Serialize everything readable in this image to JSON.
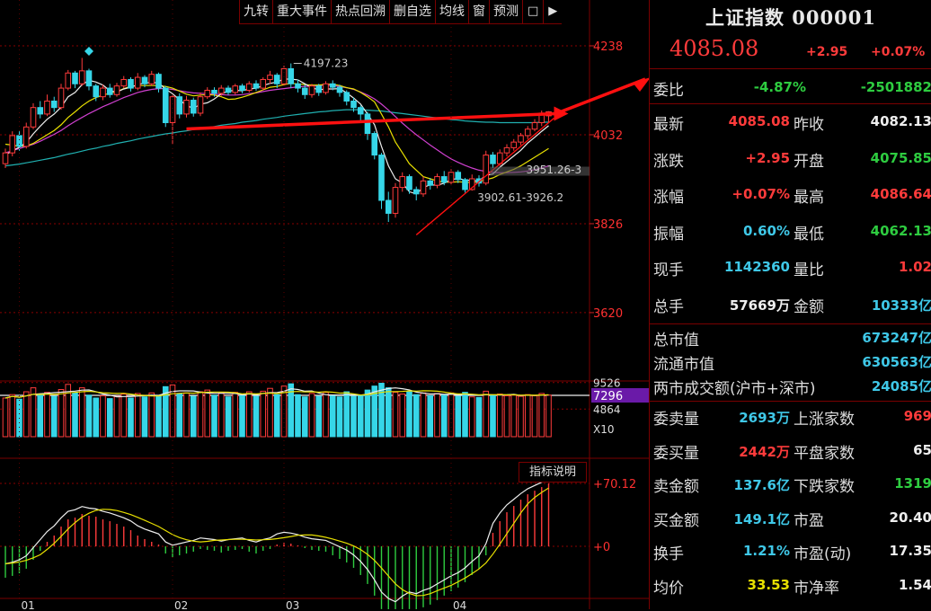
{
  "toolbar": {
    "items": [
      "九转",
      "重大事件",
      "热点回溯",
      "删自选",
      "均线",
      "窗",
      "预测"
    ],
    "lock_icon": "lock-icon",
    "exit_icon": "exit-icon"
  },
  "indicator_button": "指标说明",
  "colors": {
    "up": "#ff3b3b",
    "down": "#36d6e8",
    "ma5": "#eeeeee",
    "ma10": "#e8e000",
    "ma20": "#d040d0",
    "ma60": "#20b0b0",
    "arrow": "#ff1010"
  },
  "chart_data": {
    "type": "candlestick",
    "price_axis": {
      "ticks": [
        "4238",
        "4032",
        "3826",
        "3620"
      ],
      "ylim": [
        3470,
        4290
      ]
    },
    "volume_axis": {
      "ticks": [
        "9526",
        "4864",
        "X10"
      ],
      "current": "7296",
      "ylim": [
        0,
        9800
      ]
    },
    "macd_axis": {
      "ticks": [
        "+70.12",
        "+0"
      ],
      "ylim": [
        -95,
        105
      ]
    },
    "x_ticks": [
      {
        "label": "01",
        "index": 2
      },
      {
        "label": "02",
        "index": 24
      },
      {
        "label": "03",
        "index": 40
      },
      {
        "label": "04",
        "index": 64
      }
    ],
    "annotations": [
      {
        "text": "4197.23",
        "index": 41,
        "value": 4197.23,
        "kind": "high"
      },
      {
        "text": "3951.26-3",
        "index": 74,
        "value": 3951,
        "kind": "label"
      },
      {
        "text": "3902.61-3926.2",
        "index": 67,
        "value": 3902.61,
        "kind": "label"
      }
    ],
    "candles": [
      {
        "o": 3965,
        "c": 3990,
        "h": 4000,
        "l": 3955
      },
      {
        "o": 3990,
        "c": 4030,
        "h": 4040,
        "l": 3982
      },
      {
        "o": 4030,
        "c": 4005,
        "h": 4040,
        "l": 3995
      },
      {
        "o": 4005,
        "c": 4050,
        "h": 4060,
        "l": 4000
      },
      {
        "o": 4050,
        "c": 4095,
        "h": 4105,
        "l": 4045
      },
      {
        "o": 4095,
        "c": 4080,
        "h": 4110,
        "l": 4070
      },
      {
        "o": 4080,
        "c": 4110,
        "h": 4125,
        "l": 4075
      },
      {
        "o": 4110,
        "c": 4095,
        "h": 4120,
        "l": 4085
      },
      {
        "o": 4095,
        "c": 4140,
        "h": 4150,
        "l": 4090
      },
      {
        "o": 4140,
        "c": 4175,
        "h": 4182,
        "l": 4135
      },
      {
        "o": 4175,
        "c": 4150,
        "h": 4180,
        "l": 4140
      },
      {
        "o": 4150,
        "c": 4180,
        "h": 4210,
        "l": 4145
      },
      {
        "o": 4180,
        "c": 4145,
        "h": 4185,
        "l": 4135
      },
      {
        "o": 4145,
        "c": 4120,
        "h": 4150,
        "l": 4110
      },
      {
        "o": 4120,
        "c": 4140,
        "h": 4148,
        "l": 4112
      },
      {
        "o": 4140,
        "c": 4125,
        "h": 4150,
        "l": 4118
      },
      {
        "o": 4125,
        "c": 4145,
        "h": 4152,
        "l": 4120
      },
      {
        "o": 4145,
        "c": 4160,
        "h": 4168,
        "l": 4140
      },
      {
        "o": 4160,
        "c": 4140,
        "h": 4165,
        "l": 4132
      },
      {
        "o": 4140,
        "c": 4165,
        "h": 4175,
        "l": 4135
      },
      {
        "o": 4165,
        "c": 4150,
        "h": 4170,
        "l": 4142
      },
      {
        "o": 4150,
        "c": 4172,
        "h": 4180,
        "l": 4145
      },
      {
        "o": 4172,
        "c": 4140,
        "h": 4176,
        "l": 4130
      },
      {
        "o": 4140,
        "c": 4060,
        "h": 4145,
        "l": 4050
      },
      {
        "o": 4060,
        "c": 4120,
        "h": 4125,
        "l": 4010
      },
      {
        "o": 4120,
        "c": 4080,
        "h": 4128,
        "l": 4070
      },
      {
        "o": 4080,
        "c": 4112,
        "h": 4122,
        "l": 4072
      },
      {
        "o": 4112,
        "c": 4082,
        "h": 4118,
        "l": 4074
      },
      {
        "o": 4082,
        "c": 4120,
        "h": 4130,
        "l": 4075
      },
      {
        "o": 4120,
        "c": 4135,
        "h": 4142,
        "l": 4115
      },
      {
        "o": 4135,
        "c": 4128,
        "h": 4142,
        "l": 4120
      },
      {
        "o": 4128,
        "c": 4140,
        "h": 4147,
        "l": 4122
      },
      {
        "o": 4140,
        "c": 4130,
        "h": 4146,
        "l": 4124
      },
      {
        "o": 4130,
        "c": 4145,
        "h": 4150,
        "l": 4125
      },
      {
        "o": 4145,
        "c": 4135,
        "h": 4150,
        "l": 4128
      },
      {
        "o": 4135,
        "c": 4150,
        "h": 4156,
        "l": 4130
      },
      {
        "o": 4150,
        "c": 4140,
        "h": 4158,
        "l": 4134
      },
      {
        "o": 4140,
        "c": 4160,
        "h": 4165,
        "l": 4135
      },
      {
        "o": 4160,
        "c": 4170,
        "h": 4180,
        "l": 4150
      },
      {
        "o": 4170,
        "c": 4150,
        "h": 4175,
        "l": 4140
      },
      {
        "o": 4150,
        "c": 4185,
        "h": 4192,
        "l": 4145
      },
      {
        "o": 4185,
        "c": 4150,
        "h": 4197.23,
        "l": 4140
      },
      {
        "o": 4150,
        "c": 4140,
        "h": 4160,
        "l": 4130
      },
      {
        "o": 4140,
        "c": 4125,
        "h": 4148,
        "l": 4115
      },
      {
        "o": 4125,
        "c": 4145,
        "h": 4150,
        "l": 4118
      },
      {
        "o": 4145,
        "c": 4130,
        "h": 4150,
        "l": 4122
      },
      {
        "o": 4130,
        "c": 4150,
        "h": 4156,
        "l": 4125
      },
      {
        "o": 4150,
        "c": 4142,
        "h": 4158,
        "l": 4135
      },
      {
        "o": 4142,
        "c": 4130,
        "h": 4148,
        "l": 4120
      },
      {
        "o": 4130,
        "c": 4110,
        "h": 4135,
        "l": 4100
      },
      {
        "o": 4110,
        "c": 4095,
        "h": 4118,
        "l": 4085
      },
      {
        "o": 4095,
        "c": 4080,
        "h": 4100,
        "l": 4065
      },
      {
        "o": 4080,
        "c": 4035,
        "h": 4085,
        "l": 4020
      },
      {
        "o": 4035,
        "c": 3985,
        "h": 4040,
        "l": 3975
      },
      {
        "o": 3985,
        "c": 3880,
        "h": 3990,
        "l": 3860
      },
      {
        "o": 3880,
        "c": 3850,
        "h": 3900,
        "l": 3830
      },
      {
        "o": 3850,
        "c": 3910,
        "h": 3920,
        "l": 3840
      },
      {
        "o": 3910,
        "c": 3935,
        "h": 3945,
        "l": 3900
      },
      {
        "o": 3935,
        "c": 3905,
        "h": 3940,
        "l": 3895
      },
      {
        "o": 3905,
        "c": 3895,
        "h": 3912,
        "l": 3880
      },
      {
        "o": 3895,
        "c": 3925,
        "h": 3935,
        "l": 3888
      },
      {
        "o": 3925,
        "c": 3915,
        "h": 3932,
        "l": 3905
      },
      {
        "o": 3915,
        "c": 3935,
        "h": 3942,
        "l": 3908
      },
      {
        "o": 3935,
        "c": 3922,
        "h": 3948,
        "l": 3915
      },
      {
        "o": 3922,
        "c": 3945,
        "h": 3952,
        "l": 3915
      },
      {
        "o": 3945,
        "c": 3928,
        "h": 3950,
        "l": 3920
      },
      {
        "o": 3928,
        "c": 3905,
        "h": 3932,
        "l": 3898
      },
      {
        "o": 3905,
        "c": 3930,
        "h": 3940,
        "l": 3902.61
      },
      {
        "o": 3930,
        "c": 3920,
        "h": 3938,
        "l": 3912
      },
      {
        "o": 3920,
        "c": 3985,
        "h": 3995,
        "l": 3915
      },
      {
        "o": 3985,
        "c": 3965,
        "h": 3992,
        "l": 3955
      },
      {
        "o": 3965,
        "c": 3990,
        "h": 3998,
        "l": 3960
      },
      {
        "o": 3990,
        "c": 4002,
        "h": 4010,
        "l": 3982
      },
      {
        "o": 4002,
        "c": 4015,
        "h": 4022,
        "l": 3995
      },
      {
        "o": 4015,
        "c": 4030,
        "h": 4036,
        "l": 4008
      },
      {
        "o": 4030,
        "c": 4045,
        "h": 4052,
        "l": 4022
      },
      {
        "o": 4045,
        "c": 4060,
        "h": 4068,
        "l": 4040
      },
      {
        "o": 4060,
        "c": 4082.13,
        "h": 4088,
        "l": 4052
      },
      {
        "o": 4075.85,
        "c": 4085.08,
        "h": 4086.64,
        "l": 4062.13
      }
    ],
    "volume": [
      6800,
      7400,
      6600,
      7900,
      8600,
      7300,
      7800,
      7100,
      8300,
      9200,
      7700,
      8600,
      7300,
      6800,
      7200,
      6700,
      7100,
      7500,
      6800,
      7600,
      7000,
      7700,
      7200,
      8800,
      9100,
      7500,
      7700,
      7100,
      7900,
      8200,
      7300,
      7700,
      7000,
      7800,
      7200,
      7900,
      7100,
      8000,
      8500,
      7400,
      8900,
      9300,
      7400,
      7000,
      7600,
      7100,
      7800,
      7200,
      7000,
      7900,
      7100,
      7300,
      8200,
      8900,
      9400,
      8600,
      7800,
      7500,
      7900,
      7400,
      7700,
      7200,
      7600,
      7300,
      7700,
      7100,
      7800,
      7000,
      6900,
      8000,
      7200,
      7500,
      7200,
      7300,
      7100,
      7400,
      7200,
      7600,
      7300
    ],
    "macd": [
      -35,
      -33,
      -30,
      -25,
      -15,
      -5,
      5,
      12,
      22,
      30,
      32,
      36,
      34,
      33,
      30,
      28,
      25,
      22,
      18,
      12,
      8,
      5,
      2,
      -8,
      -12,
      -10,
      -8,
      -6,
      -3,
      -4,
      -5,
      -7,
      -5,
      -4,
      -3,
      -6,
      -8,
      -5,
      -3,
      2,
      4,
      3,
      1,
      -2,
      -4,
      -5,
      -6,
      -10,
      -14,
      -18,
      -24,
      -32,
      -42,
      -55,
      -70,
      -78,
      -82,
      -75,
      -70,
      -72,
      -68,
      -65,
      -60,
      -55,
      -50,
      -46,
      -40,
      -32,
      -25,
      -10,
      15,
      28,
      38,
      45,
      52,
      58,
      62,
      66,
      70.12
    ],
    "ma5": [
      3985,
      3995,
      4003,
      4014,
      4034,
      4052,
      4068,
      4080,
      4096,
      4120,
      4130,
      4148,
      4158,
      4154,
      4147,
      4134,
      4131,
      4138,
      4142,
      4148,
      4152,
      4153,
      4152,
      4138,
      4127,
      4113,
      4100,
      4093,
      4103,
      4106,
      4115,
      4127,
      4133,
      4135,
      4134,
      4138,
      4140,
      4146,
      4151,
      4154,
      4161,
      4161,
      4159,
      4150,
      4141,
      4136,
      4138,
      4138,
      4139,
      4129,
      4117,
      4103,
      4080,
      4055,
      4005,
      3960,
      3930,
      3920,
      3900,
      3895,
      3910,
      3916,
      3915,
      3920,
      3928,
      3931,
      3927,
      3926,
      3925,
      3938,
      3941,
      3957,
      3970,
      3983,
      3996,
      4013,
      4026,
      4040,
      4053
    ],
    "ma10": [
      4010,
      4008,
      4005,
      4006,
      4012,
      4022,
      4032,
      4042,
      4055,
      4072,
      4085,
      4099,
      4110,
      4118,
      4124,
      4128,
      4132,
      4139,
      4144,
      4146,
      4146,
      4146,
      4146,
      4144,
      4140,
      4133,
      4126,
      4122,
      4124,
      4125,
      4124,
      4120,
      4114,
      4115,
      4119,
      4124,
      4130,
      4136,
      4142,
      4144,
      4148,
      4151,
      4150,
      4148,
      4147,
      4147,
      4149,
      4149,
      4146,
      4141,
      4138,
      4130,
      4120,
      4108,
      4080,
      4050,
      4015,
      3990,
      3965,
      3950,
      3935,
      3930,
      3925,
      3922,
      3922,
      3923,
      3922,
      3921,
      3923,
      3928,
      3932,
      3940,
      3946,
      3952,
      3960,
      3970,
      3980,
      3990,
      4000
    ],
    "ma20": [
      3990,
      3995,
      4000,
      4005,
      4010,
      4017,
      4025,
      4033,
      4042,
      4053,
      4063,
      4072,
      4081,
      4089,
      4097,
      4104,
      4111,
      4118,
      4124,
      4130,
      4134,
      4137,
      4139,
      4139,
      4137,
      4134,
      4131,
      4129,
      4128,
      4127,
      4126,
      4125,
      4124,
      4124,
      4125,
      4127,
      4129,
      4132,
      4135,
      4137,
      4139,
      4141,
      4143,
      4144,
      4145,
      4146,
      4147,
      4146,
      4144,
      4141,
      4137,
      4131,
      4124,
      4115,
      4103,
      4089,
      4074,
      4059,
      4045,
      4032,
      4020,
      4008,
      3997,
      3986,
      3976,
      3968,
      3961,
      3955,
      3950,
      3947,
      3945,
      3944,
      3944,
      3945,
      3946,
      3948,
      3951,
      3955,
      3960
    ],
    "ma60": [
      3960,
      3962,
      3964,
      3967,
      3970,
      3973,
      3976,
      3979,
      3983,
      3987,
      3990,
      3994,
      3998,
      4001,
      4005,
      4008,
      4012,
      4015,
      4018,
      4022,
      4025,
      4028,
      4031,
      4034,
      4036,
      4039,
      4041,
      4044,
      4046,
      4049,
      4051,
      4054,
      4056,
      4058,
      4061,
      4063,
      4065,
      4068,
      4070,
      4072,
      4075,
      4077,
      4079,
      4081,
      4083,
      4085,
      4086,
      4088,
      4089,
      4090,
      4090,
      4090,
      4089,
      4088,
      4087,
      4085,
      4083,
      4081,
      4079,
      4077,
      4075,
      4073,
      4071,
      4069,
      4067,
      4066,
      4064,
      4063,
      4062,
      4061,
      4061,
      4060,
      4060,
      4060,
      4060,
      4060,
      4060,
      4061,
      4061
    ]
  },
  "quote": {
    "title": "上证指数 000001",
    "price": "4085.08",
    "change": "+2.95",
    "change_pct": "+0.07%",
    "weibi": {
      "label": "委比",
      "pct": "-4.87%",
      "diff": "-2501882"
    },
    "rows": [
      {
        "l1": "最新",
        "v1": "4085.08",
        "c1": "red",
        "l2": "昨收",
        "v2": "4082.13",
        "c2": "white"
      },
      {
        "l1": "涨跌",
        "v1": "+2.95",
        "c1": "red",
        "l2": "开盘",
        "v2": "4075.85",
        "c2": "green"
      },
      {
        "l1": "涨幅",
        "v1": "+0.07%",
        "c1": "red",
        "l2": "最高",
        "v2": "4086.64",
        "c2": "red"
      },
      {
        "l1": "振幅",
        "v1": "0.60%",
        "c1": "cyan",
        "l2": "最低",
        "v2": "4062.13",
        "c2": "green"
      },
      {
        "l1": "现手",
        "v1": "1142360",
        "c1": "cyan",
        "l2": "量比",
        "v2": "1.02",
        "c2": "red"
      },
      {
        "l1": "总手",
        "v1": "57669万",
        "c1": "white",
        "l2": "金额",
        "v2": "10333亿",
        "c2": "cyan"
      }
    ],
    "market": [
      {
        "label": "总市值",
        "value": "673247亿"
      },
      {
        "label": "流通市值",
        "value": "630563亿"
      },
      {
        "label": "两市成交额(沪市+深市)",
        "value": "24085亿"
      }
    ],
    "rows2": [
      {
        "l1": "委卖量",
        "v1": "2693万",
        "c1": "cyan",
        "l2": "上涨家数",
        "v2": "969",
        "c2": "red"
      },
      {
        "l1": "委买量",
        "v1": "2442万",
        "c1": "red",
        "l2": "平盘家数",
        "v2": "65",
        "c2": "white"
      },
      {
        "l1": "卖金额",
        "v1": "137.6亿",
        "c1": "cyan",
        "l2": "下跌家数",
        "v2": "1319",
        "c2": "green"
      },
      {
        "l1": "买金额",
        "v1": "149.1亿",
        "c1": "cyan",
        "l2": "市盈",
        "v2": "20.40",
        "c2": "white"
      },
      {
        "l1": "换手",
        "v1": "1.21%",
        "c1": "cyan",
        "l2": "市盈(动)",
        "v2": "17.35",
        "c2": "white"
      },
      {
        "l1": "均价",
        "v1": "33.53",
        "c1": "yellow",
        "l2": "市净率",
        "v2": "1.54",
        "c2": "white"
      }
    ]
  }
}
